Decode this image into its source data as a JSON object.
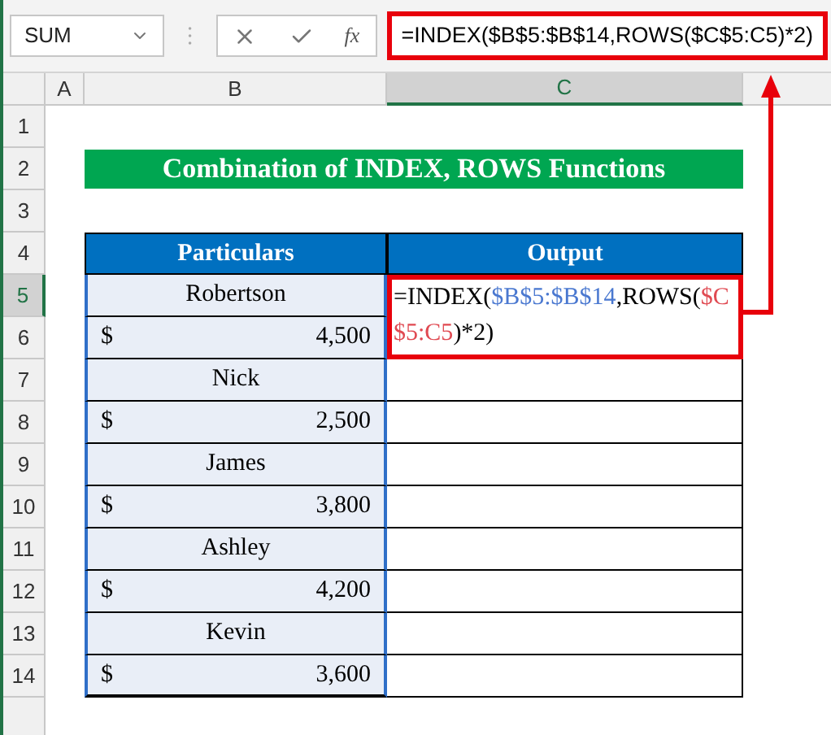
{
  "formula_bar": {
    "name_box": "SUM",
    "fx_label": "fx",
    "formula": "=INDEX($B$5:$B$14,ROWS($C$5:C5)*2)",
    "highlighted": true
  },
  "columns": [
    {
      "label": "A",
      "selected": false
    },
    {
      "label": "B",
      "selected": false
    },
    {
      "label": "C",
      "selected": true
    }
  ],
  "row_numbers": [
    {
      "label": "1",
      "selected": false
    },
    {
      "label": "2",
      "selected": false
    },
    {
      "label": "3",
      "selected": false
    },
    {
      "label": "4",
      "selected": false
    },
    {
      "label": "5",
      "selected": true
    },
    {
      "label": "6",
      "selected": false
    },
    {
      "label": "7",
      "selected": false
    },
    {
      "label": "8",
      "selected": false
    },
    {
      "label": "9",
      "selected": false
    },
    {
      "label": "10",
      "selected": false
    },
    {
      "label": "11",
      "selected": false
    },
    {
      "label": "12",
      "selected": false
    },
    {
      "label": "13",
      "selected": false
    },
    {
      "label": "14",
      "selected": false
    }
  ],
  "banner": "Combination of INDEX, ROWS Functions",
  "table": {
    "headers": [
      "Particulars",
      "Output"
    ],
    "rows": [
      {
        "kind": "name",
        "text": "Robertson"
      },
      {
        "kind": "amount",
        "currency": "$",
        "value": "4,500"
      },
      {
        "kind": "name",
        "text": "Nick"
      },
      {
        "kind": "amount",
        "currency": "$",
        "value": "2,500"
      },
      {
        "kind": "name",
        "text": "James"
      },
      {
        "kind": "amount",
        "currency": "$",
        "value": "3,800"
      },
      {
        "kind": "name",
        "text": "Ashley"
      },
      {
        "kind": "amount",
        "currency": "$",
        "value": "4,200"
      },
      {
        "kind": "name",
        "text": "Kevin"
      },
      {
        "kind": "amount",
        "currency": "$",
        "value": "3,600"
      }
    ],
    "output_formula": [
      {
        "text": "=INDEX(",
        "color": "#000000"
      },
      {
        "text": "$B$5:$B$14",
        "color": "#4a78d0"
      },
      {
        "text": ",ROWS(",
        "color": "#000000"
      },
      {
        "text": "$C$5:C5",
        "color": "#e04a52"
      },
      {
        "text": ")*2)",
        "color": "#000000"
      }
    ]
  }
}
